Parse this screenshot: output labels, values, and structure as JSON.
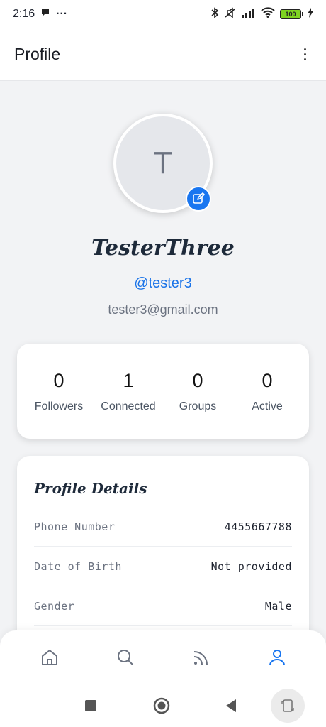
{
  "status_bar": {
    "time": "2:16",
    "dots": "···",
    "battery_level": "100"
  },
  "app_bar": {
    "title": "Profile"
  },
  "profile": {
    "avatar_initial": "T",
    "display_name": "TesterThree",
    "handle": "@tester3",
    "email": "tester3@gmail.com"
  },
  "stats": [
    {
      "value": "0",
      "label": "Followers"
    },
    {
      "value": "1",
      "label": "Connected"
    },
    {
      "value": "0",
      "label": "Groups"
    },
    {
      "value": "0",
      "label": "Active"
    }
  ],
  "details": {
    "title": "Profile Details",
    "rows": [
      {
        "label": "Phone Number",
        "value": "4455667788"
      },
      {
        "label": "Date of Birth",
        "value": "Not provided"
      },
      {
        "label": "Gender",
        "value": "Male"
      }
    ]
  },
  "bottom_nav": {
    "items": [
      {
        "icon": "home-icon",
        "active": false
      },
      {
        "icon": "search-icon",
        "active": false
      },
      {
        "icon": "feed-icon",
        "active": false
      },
      {
        "icon": "profile-icon",
        "active": true
      }
    ]
  },
  "colors": {
    "accent": "#1976f0",
    "text_dark": "#1e2a3a",
    "muted": "#6b7280",
    "background": "#f2f3f5"
  }
}
